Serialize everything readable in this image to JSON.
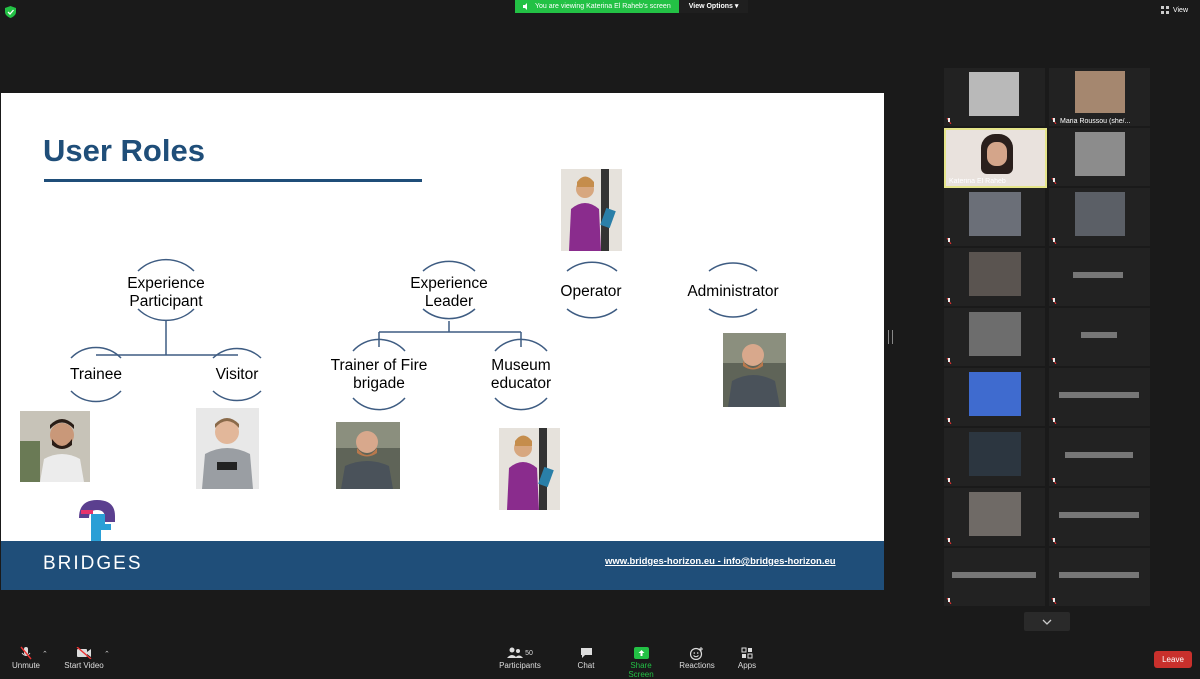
{
  "topbar": {
    "viewing_text": "You are viewing Katerina El Raheb's screen",
    "view_options": "View Options",
    "view_label": "View"
  },
  "slide": {
    "title": "User Roles",
    "roles": {
      "experience_participant": [
        "Experience",
        "Participant"
      ],
      "experience_leader": [
        "Experience",
        "Leader"
      ],
      "operator": "Operator",
      "administrator": "Administrator",
      "trainee": "Trainee",
      "visitor": "Visitor",
      "trainer": [
        "Trainer of Fire",
        "brigade"
      ],
      "museum_educator": [
        "Museum",
        "educator"
      ]
    },
    "footer_brand": "BRIDGES",
    "footer_contact": "www.bridges-horizon.eu - info@bridges-horizon.eu"
  },
  "gallery": {
    "named_tiles": [
      "Maria Roussou (she/...",
      "Katerina El Raheb"
    ]
  },
  "toolbar": {
    "unmute": "Unmute",
    "start_video": "Start Video",
    "participants": "Participants",
    "participants_count": "50",
    "chat": "Chat",
    "share_screen": "Share Screen",
    "reactions": "Reactions",
    "apps": "Apps",
    "leave": "Leave"
  },
  "colors": {
    "share_green": "#23c145",
    "slide_blue": "#1f4e79",
    "leave_red": "#c9302c",
    "active_speaker": "#e5e58a"
  }
}
